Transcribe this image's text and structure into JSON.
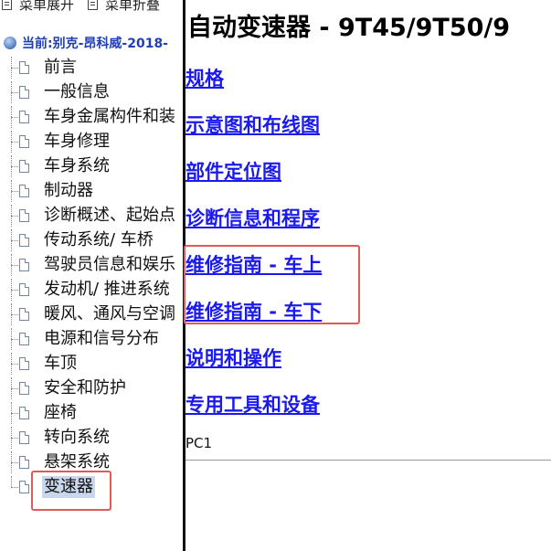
{
  "toolbar": {
    "expand_label": "菜单展开",
    "collapse_label": "菜单折叠"
  },
  "tree": {
    "root_label": "当前:别克-昂科威-2018-",
    "items": [
      "前言",
      "一般信息",
      "车身金属构件和装",
      "车身修理",
      "车身系统",
      "制动器",
      "诊断概述、起始点",
      "传动系统/ 车桥",
      "驾驶员信息和娱乐",
      "发动机/ 推进系统",
      "暖风、通风与空调",
      "电源和信号分布",
      "车顶",
      "安全和防护",
      "座椅",
      "转向系统",
      "悬架系统",
      "变速器"
    ],
    "selected_index": 17
  },
  "content": {
    "title": "自动变速器 - 9T45/9T50/9",
    "links": [
      "规格",
      "示意图和布线图",
      "部件定位图",
      "诊断信息和程序",
      "维修指南 - 车上",
      "维修指南 - 车下",
      "说明和操作",
      "专用工具和设备"
    ],
    "footer_code": "PC1"
  },
  "colors": {
    "link": "#1a1aee",
    "highlight_box": "#e05a5a",
    "selected_bg": "#c9d6ec"
  }
}
